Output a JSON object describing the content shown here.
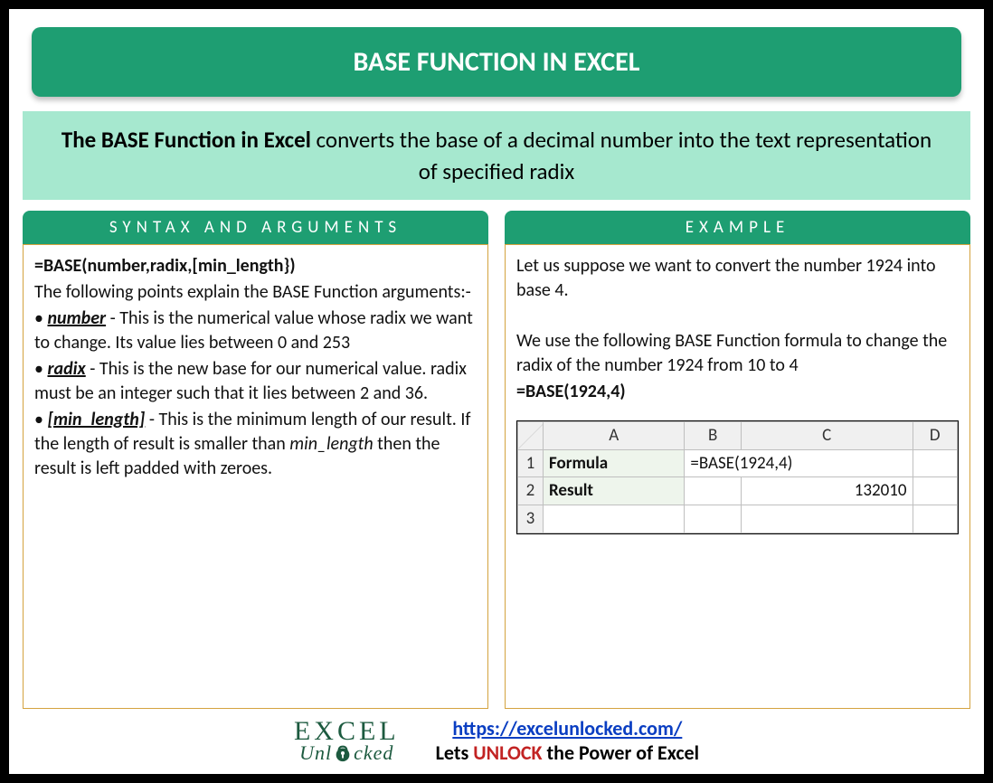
{
  "title": "BASE FUNCTION IN EXCEL",
  "description": {
    "bold_prefix": "The BASE Function in Excel",
    "rest": " converts the base of a decimal number into the text representation of specified radix"
  },
  "syntax": {
    "header": "SYNTAX AND ARGUMENTS",
    "formula": "=BASE(number,radix,[min_length})",
    "intro": "The following points explain the BASE Function arguments:-",
    "args": [
      {
        "name": "number",
        "text": " - This is the numerical value whose radix we want to change. Its value lies between 0 and 253"
      },
      {
        "name": "radix",
        "text": " - This is the new base for our numerical value. radix must be an integer such that it lies between 2 and 36."
      },
      {
        "name": "[min_length]",
        "text_before": " - This is the minimum length of our result. If the length of result is smaller than ",
        "ital": "min_length",
        "text_after": " then the result is left padded with zeroes."
      }
    ]
  },
  "example": {
    "header": "EXAMPLE",
    "p1": "Let us suppose we want to convert the number 1924 into base 4.",
    "p2": "We use the following BASE Function formula to change the radix of the number 1924 from 10 to 4",
    "formula": "=BASE(1924,4)",
    "table": {
      "cols": [
        "A",
        "B",
        "C",
        "D"
      ],
      "rows": [
        {
          "n": "1",
          "label": "Formula",
          "b": "=BASE(1924,4)",
          "c": "",
          "d": ""
        },
        {
          "n": "2",
          "label": "Result",
          "b": "",
          "c": "132010",
          "d": ""
        },
        {
          "n": "3",
          "label": "",
          "b": "",
          "c": "",
          "d": ""
        }
      ]
    }
  },
  "footer": {
    "logo_top": "EXCEL",
    "logo_bottom_pre": "Unl",
    "logo_bottom_post": "cked",
    "url": "https://excelunlocked.com/",
    "tagline_pre": "Lets ",
    "tagline_word": "UNLOCK",
    "tagline_post": " the Power of Excel"
  }
}
